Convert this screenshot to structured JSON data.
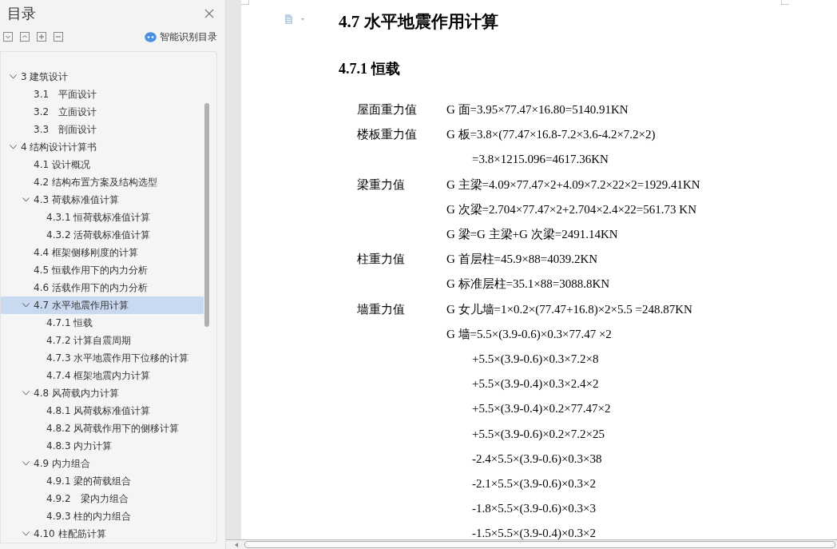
{
  "toc_panel": {
    "title": "目录",
    "smart_button": "智能识别目录",
    "items": [
      {
        "label": "3 建筑设计",
        "expanded": true,
        "selected": false,
        "children": [
          {
            "label": "3.1　平面设计",
            "selected": false
          },
          {
            "label": "3.2　立面设计",
            "selected": false
          },
          {
            "label": "3.3　剖面设计",
            "selected": false
          }
        ]
      },
      {
        "label": "4 结构设计计算书",
        "expanded": true,
        "selected": false,
        "children": [
          {
            "label": "4.1 设计概况",
            "selected": false
          },
          {
            "label": "4.2 结构布置方案及结构选型",
            "selected": false
          },
          {
            "label": "4.3 荷载标准值计算",
            "expanded": true,
            "selected": false,
            "children": [
              {
                "label": "4.3.1 恒荷载标准值计算",
                "selected": false
              },
              {
                "label": "4.3.2 活荷载标准值计算",
                "selected": false
              }
            ]
          },
          {
            "label": "4.4 框架侧移刚度的计算",
            "selected": false
          },
          {
            "label": "4.5 恒载作用下的内力分析",
            "selected": false
          },
          {
            "label": "4.6 活载作用下的内力分析",
            "selected": false
          },
          {
            "label": "4.7 水平地震作用计算",
            "expanded": true,
            "selected": true,
            "children": [
              {
                "label": "4.7.1 恒载",
                "selected": false
              },
              {
                "label": "4.7.2 计算自震周期",
                "selected": false
              },
              {
                "label": "4.7.3 水平地震作用下位移的计算",
                "selected": false
              },
              {
                "label": "4.7.4 框架地震内力计算",
                "selected": false
              }
            ]
          },
          {
            "label": "4.8 风荷载内力计算",
            "expanded": true,
            "selected": false,
            "children": [
              {
                "label": "4.8.1 风荷载标准值计算",
                "selected": false
              },
              {
                "label": "4.8.2 风荷载作用下的侧移计算",
                "selected": false
              },
              {
                "label": "4.8.3 内力计算",
                "selected": false
              }
            ]
          },
          {
            "label": "4.9 内力组合",
            "expanded": true,
            "selected": false,
            "children": [
              {
                "label": "4.9.1 梁的荷载组合",
                "selected": false
              },
              {
                "label": "4.9.2　梁内力组合",
                "selected": false
              },
              {
                "label": "4.9.3 柱的内力组合",
                "selected": false
              }
            ]
          },
          {
            "label": "4.10 柱配筋计算",
            "expanded": true,
            "selected": false
          }
        ]
      }
    ]
  },
  "document": {
    "heading": "4.7 水平地震作用计算",
    "subheading": "4.7.1 恒载",
    "rows": [
      {
        "kind": "formula",
        "label": "屋面重力值",
        "text": "G 面=3.95×77.47×16.80=5140.91KN"
      },
      {
        "kind": "formula",
        "label": "楼板重力值",
        "text": "G 板=3.8×(77.47×16.8-7.2×3.6-4.2×7.2×2)"
      },
      {
        "kind": "continuation",
        "text": "=3.8×1215.096=4617.36KN"
      },
      {
        "kind": "formula",
        "label": "梁重力值",
        "text": "G 主梁=4.09×77.47×2+4.09×7.2×22×2=1929.41KN"
      },
      {
        "kind": "formula",
        "text": "G 次梁=2.704×77.47×2+2.704×2.4×22=561.73 KN"
      },
      {
        "kind": "formula",
        "text": "G 梁=G 主梁+G 次梁=2491.14KN"
      },
      {
        "kind": "formula",
        "label": "柱重力值",
        "text": "G 首层柱=45.9×88=4039.2KN"
      },
      {
        "kind": "formula",
        "text": "G 标准层柱=35.1×88=3088.8KN"
      },
      {
        "kind": "formula",
        "label": "墙重力值",
        "text": "G 女儿墙=1×0.2×(77.47+16.8)×2×5.5 =248.87KN"
      },
      {
        "kind": "formula",
        "text": "G 墙=5.5×(3.9-0.6)×0.3×77.47 ×2"
      },
      {
        "kind": "continuation",
        "text": "+5.5×(3.9-0.6)×0.3×7.2×8"
      },
      {
        "kind": "continuation",
        "text": "+5.5×(3.9-0.4)×0.3×2.4×2"
      },
      {
        "kind": "continuation",
        "text": "+5.5×(3.9-0.4)×0.2×77.47×2"
      },
      {
        "kind": "continuation",
        "text": "+5.5×(3.9-0.6)×0.2×7.2×25"
      },
      {
        "kind": "continuation",
        "text": "-2.4×5.5×(3.9-0.6)×0.3×38"
      },
      {
        "kind": "continuation",
        "text": "-2.1×5.5×(3.9-0.6)×0.3×2"
      },
      {
        "kind": "continuation",
        "text": "-1.8×5.5×(3.9-0.6)×0.3×3"
      },
      {
        "kind": "continuation",
        "text": "-1.5×5.5×(3.9-0.4)×0.3×2"
      }
    ]
  }
}
